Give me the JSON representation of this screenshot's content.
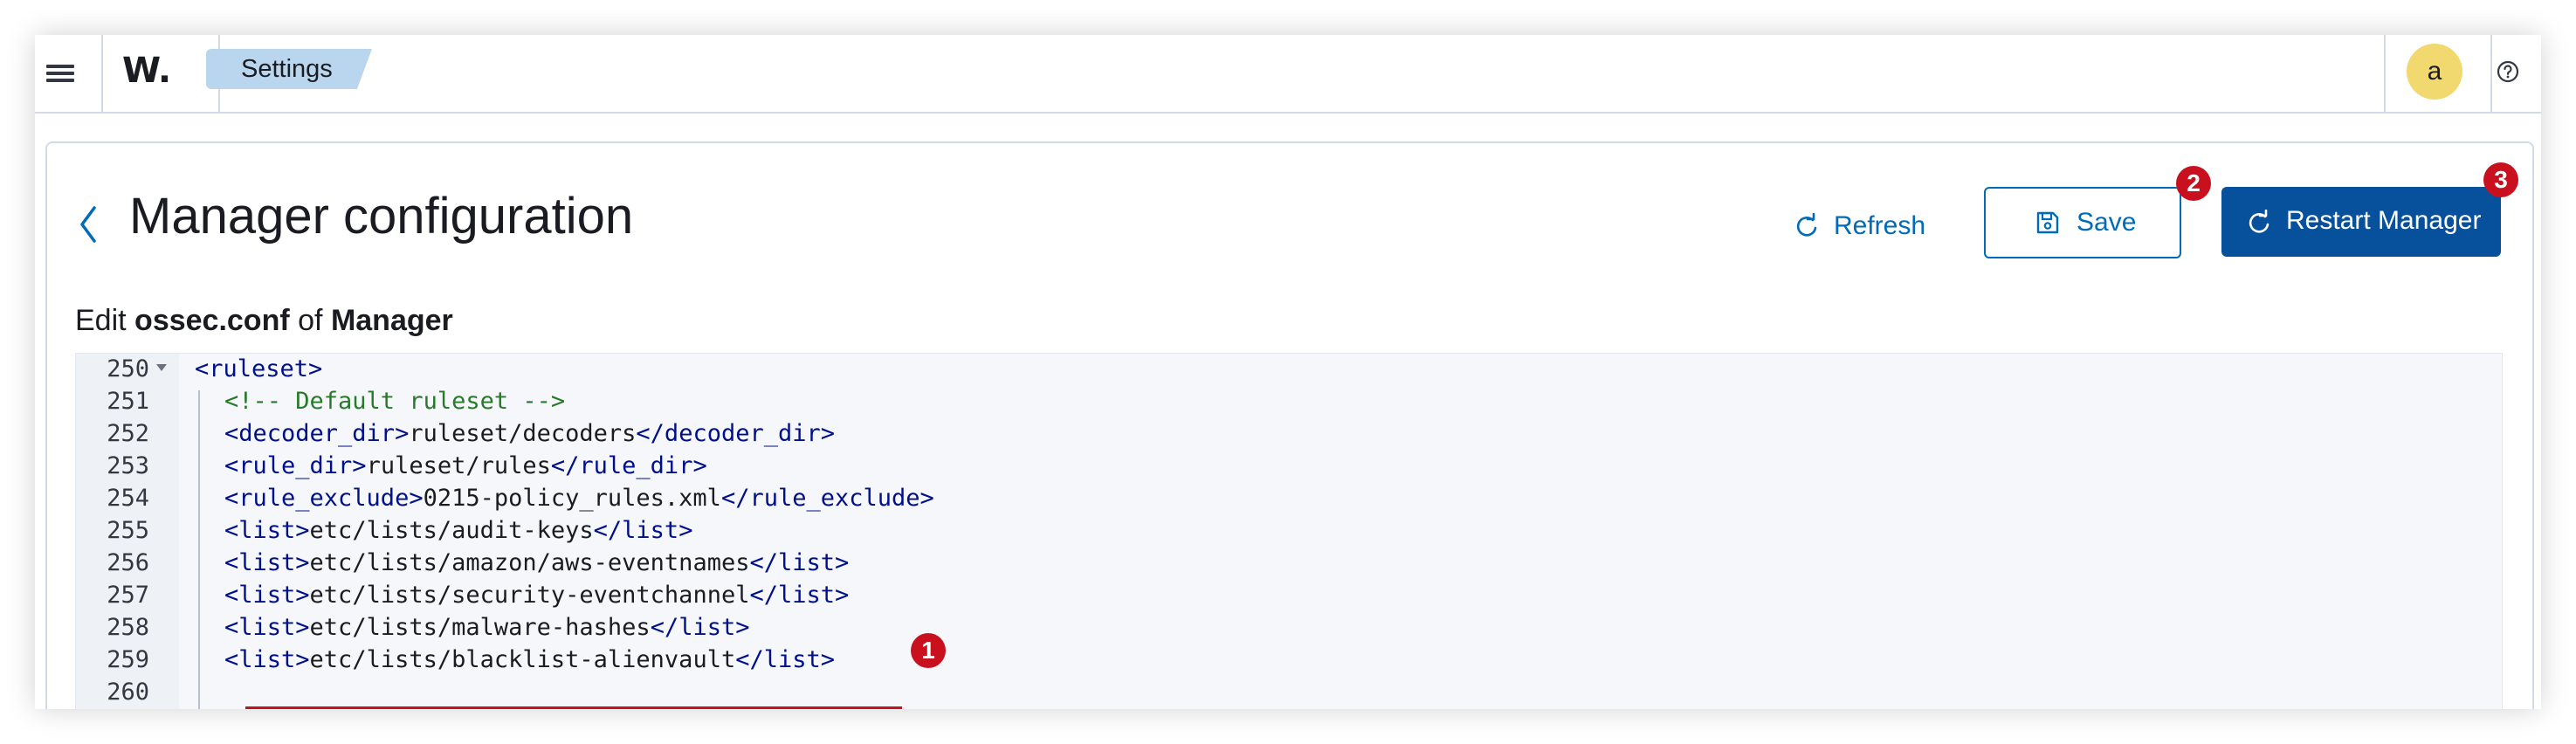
{
  "header": {
    "breadcrumb": "Settings",
    "logo_text": "W.",
    "avatar_letter": "a"
  },
  "page": {
    "title": "Manager configuration",
    "refresh_label": "Refresh",
    "save_label": "Save",
    "restart_label": "Restart Manager",
    "subtitle_prefix": "Edit",
    "subtitle_file": "ossec.conf",
    "subtitle_of": "of",
    "subtitle_target": "Manager"
  },
  "annotations": {
    "step1": "1",
    "step2": "2",
    "step3": "3"
  },
  "editor": {
    "lines": [
      {
        "num": "250",
        "open": "<ruleset>",
        "text": "",
        "close": "",
        "comment": ""
      },
      {
        "num": "251",
        "open": "",
        "text": "",
        "close": "",
        "comment": "<!-- Default ruleset -->"
      },
      {
        "num": "252",
        "open": "<decoder_dir>",
        "text": "ruleset/decoders",
        "close": "</decoder_dir>",
        "comment": ""
      },
      {
        "num": "253",
        "open": "<rule_dir>",
        "text": "ruleset/rules",
        "close": "</rule_dir>",
        "comment": ""
      },
      {
        "num": "254",
        "open": "<rule_exclude>",
        "text": "0215-policy_rules.xml",
        "close": "</rule_exclude>",
        "comment": ""
      },
      {
        "num": "255",
        "open": "<list>",
        "text": "etc/lists/audit-keys",
        "close": "</list>",
        "comment": ""
      },
      {
        "num": "256",
        "open": "<list>",
        "text": "etc/lists/amazon/aws-eventnames",
        "close": "</list>",
        "comment": ""
      },
      {
        "num": "257",
        "open": "<list>",
        "text": "etc/lists/security-eventchannel",
        "close": "</list>",
        "comment": ""
      },
      {
        "num": "258",
        "open": "<list>",
        "text": "etc/lists/malware-hashes",
        "close": "</list>",
        "comment": ""
      },
      {
        "num": "259",
        "open": "<list>",
        "text": "etc/lists/blacklist-alienvault",
        "close": "</list>",
        "comment": ""
      },
      {
        "num": "260",
        "open": "",
        "text": "",
        "close": "",
        "comment": ""
      }
    ]
  },
  "colors": {
    "primary": "#07519c",
    "link": "#006bb8",
    "badge": "#c8101e",
    "breadcrumb_bg": "#b9d6ee",
    "avatar_bg": "#f1d86f",
    "tag": "#000f8a",
    "comment": "#287a2b"
  },
  "icons": [
    "menu-icon",
    "help-icon",
    "back-arrow-icon",
    "refresh-icon",
    "save-icon",
    "restart-icon",
    "fold-arrow-icon"
  ]
}
